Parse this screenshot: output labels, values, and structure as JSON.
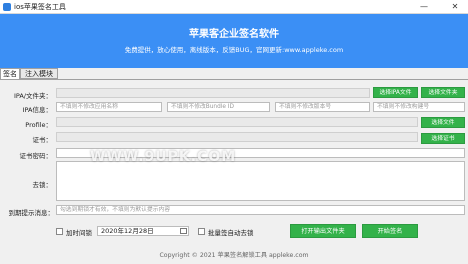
{
  "window": {
    "title": "ios苹果签名工具",
    "minimize": "—",
    "close": "✕"
  },
  "banner": {
    "title": "苹果客企业签名软件",
    "subtitle": "免费提供，放心使用，离线版本，反馈BUG，官网更新:www.appleke.com"
  },
  "tabs": [
    {
      "label": "签名"
    },
    {
      "label": "注入模块"
    }
  ],
  "form": {
    "ipa_label": "IPA/文件夹：",
    "ipa_info_label": "IPA信息：",
    "profile_label": "Profile：",
    "cert_label": "证书：",
    "cert_password_label": "证书密码：",
    "dylib_label": "去锁：",
    "expire_msg_label": "到期提示消息：",
    "app_name_placeholder": "不填则不修改应用名称",
    "bundle_id_placeholder": "不填则不修改Bundle ID",
    "version_placeholder": "不填则不修改版本号",
    "build_placeholder": "不填则不修改构建号",
    "expire_msg_placeholder": "勾选到期锁才有效，不填则为默认提示内容",
    "select_ipa_file": "选择IPA文件",
    "select_folder": "选择文件夹",
    "select_profile_file": "选择文件",
    "select_cert": "选择证书",
    "time_lock_label": "加时间锁",
    "date_value": "2020年12月28日",
    "batch_lock_label": "批量签自动去锁",
    "open_output_folder": "打开输出文件夹",
    "start_sign": "开始签名"
  },
  "watermark": "WWW.9UPK.COM",
  "footer": "Copyright © 2021 苹果签名解锁工具 appleke.com",
  "colors": {
    "banner": "#3b8ff5",
    "green_button": "#33b24a"
  }
}
